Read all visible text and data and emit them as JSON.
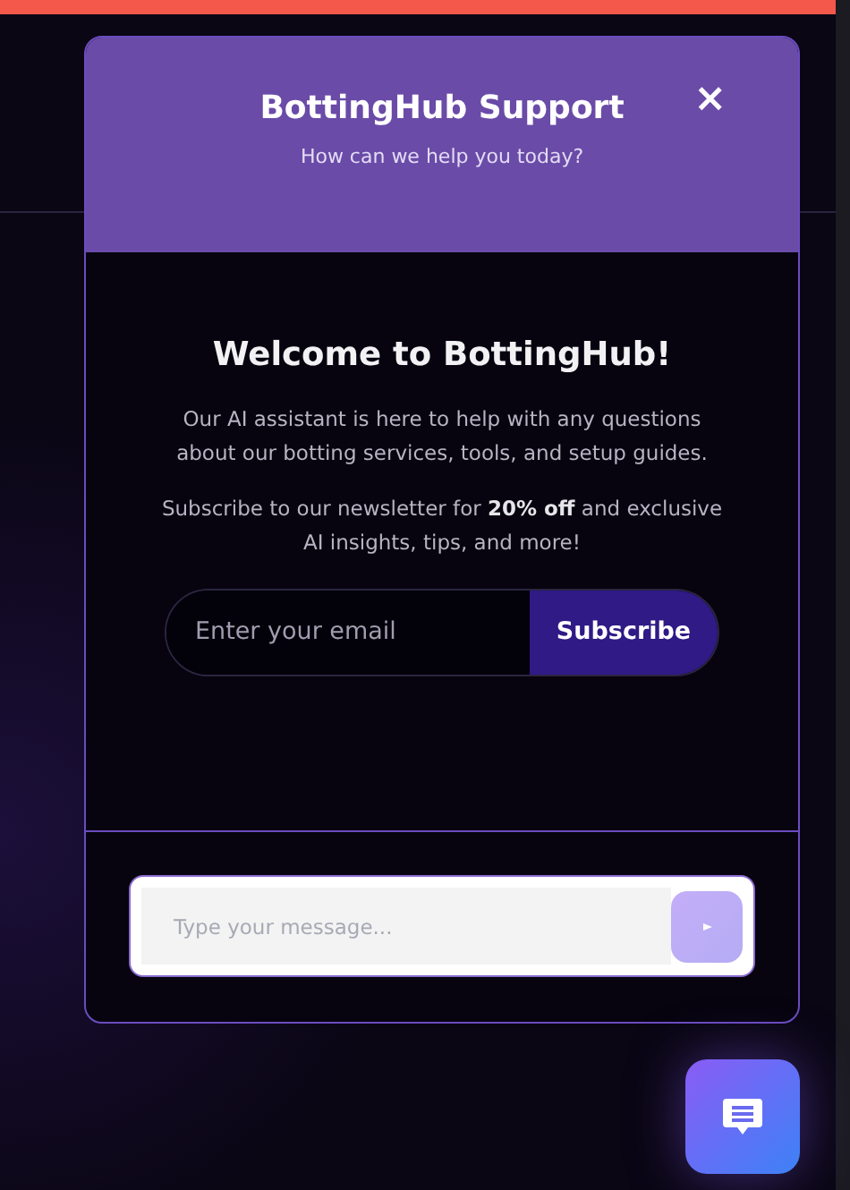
{
  "chat_window": {
    "title": "BottingHub Support",
    "subtitle": "How can we help you today?",
    "close_label": "×",
    "welcome": {
      "heading": "Welcome to BottingHub!",
      "intro": "Our AI assistant is here to help with any questions about our botting services, tools, and setup guides.",
      "offer": "Subscribe to our newsletter for **20% off** and exclusive AI insights, tips, and more!"
    },
    "newsletter": {
      "placeholder": "Enter your email",
      "button": "Subscribe"
    },
    "message_input": {
      "placeholder": "Type your message..."
    }
  }
}
